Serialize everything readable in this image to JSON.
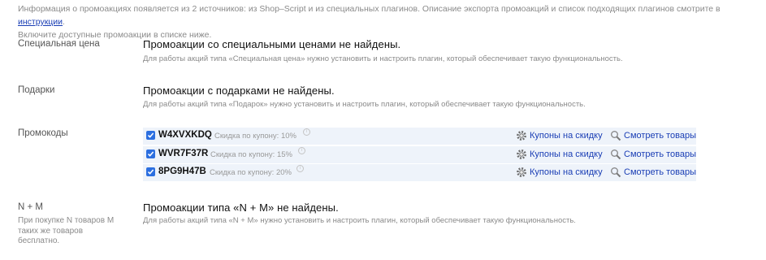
{
  "intro": {
    "line1_text": "Информация о промоакциях появляется из 2 источников: из Shop–Script и из специальных плагинов. Описание экспорта промоакций и список подходящих плагинов смотрите в ",
    "link": "инструкции",
    "line1_end": ".",
    "line2": "Включите доступные промоакции в списке ниже."
  },
  "sections": {
    "special_price": {
      "label": "Специальная цена",
      "title": "Промоакции со специальными ценами не найдены.",
      "desc": "Для работы акций типа «Специальная цена» нужно установить и настроить плагин, который обеспечивает такую функциональность."
    },
    "gifts": {
      "label": "Подарки",
      "title": "Промоакции с подарками не найдены.",
      "desc": "Для работы акций типа «Подарок» нужно установить и настроить плагин, который обеспечивает такую функциональность."
    },
    "promocodes": {
      "label": "Промокоды",
      "coupons": [
        {
          "code": "W4XVXKDQ",
          "discount": "Скидка по купону: 10%",
          "checked": true
        },
        {
          "code": "WVR7F37R",
          "discount": "Скидка по купону: 15%",
          "checked": true
        },
        {
          "code": "8PG9H47B",
          "discount": "Скидка по купону: 20%",
          "checked": true
        }
      ],
      "action_coupons": "Купоны на скидку",
      "action_products": "Смотреть товары"
    },
    "n_plus_m": {
      "label": "N + M",
      "sub": "При покупке N товаров M таких же товаров бесплатно.",
      "title": "Промоакции типа «N + M» не найдены.",
      "desc": "Для работы акций типа «N + M» нужно установить и настроить плагин, который обеспечивает такую функциональность."
    }
  },
  "icons": {
    "checkbox": "checkbox-checked-icon",
    "info": "info-icon",
    "gear": "gear-icon",
    "magnifier": "search-icon"
  },
  "colors": {
    "link": "#1a3eb5",
    "checkbox": "#2c6fe0",
    "row_bg": "#eef3fa",
    "muted": "#8a8a8a"
  }
}
